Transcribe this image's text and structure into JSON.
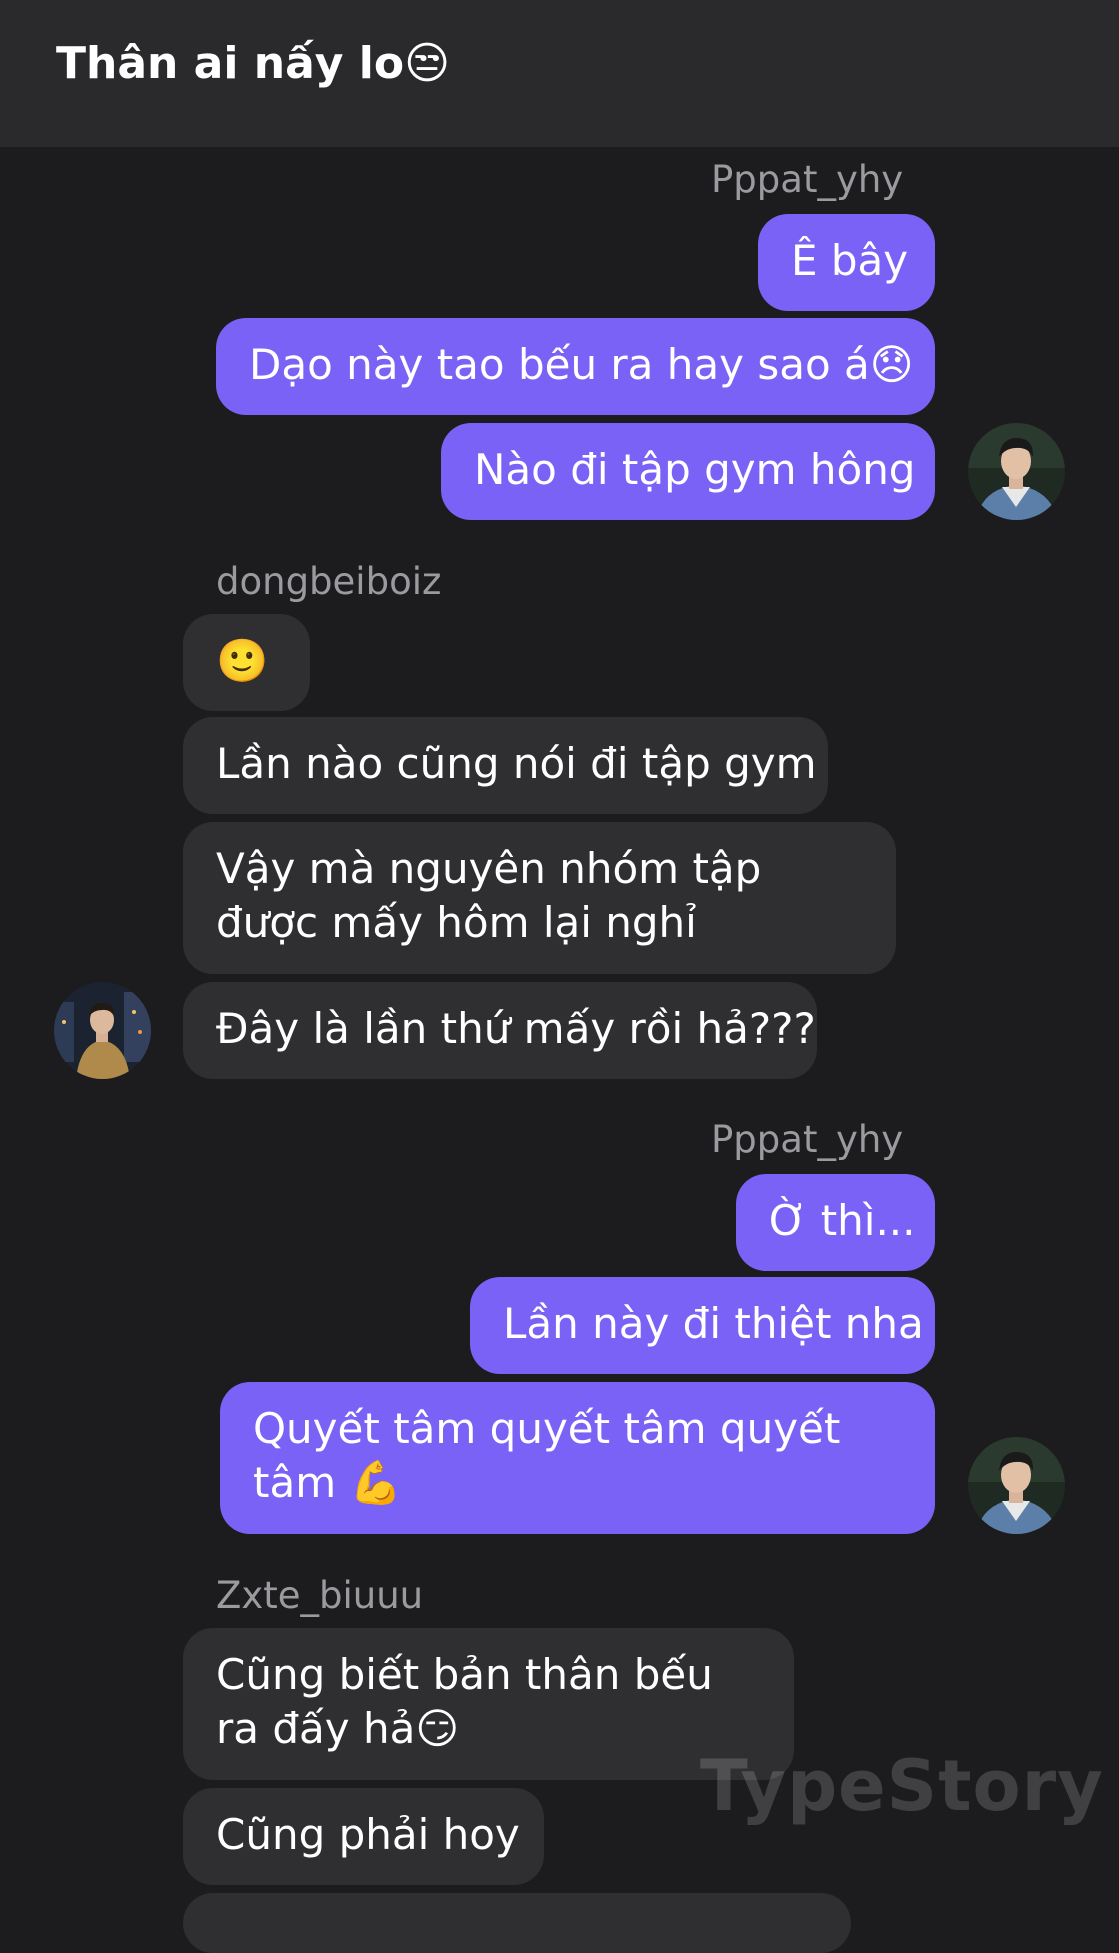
{
  "header": {
    "title": "Thân ai nấy lo😒"
  },
  "groups": [
    {
      "sender": "Pppat_yhy",
      "messages": [
        "Ê bây",
        "Dạo này tao bếu ra hay sao á😞",
        "Nào đi tập gym hông"
      ]
    },
    {
      "sender": "dongbeiboiz",
      "messages": [
        "🙂",
        "Lần nào cũng nói đi tập gym",
        "Vậy mà nguyên nhóm tập được mấy hôm lại nghỉ",
        "Đây là lần thứ mấy rồi hả???"
      ]
    },
    {
      "sender": "Pppat_yhy",
      "messages": [
        "Ờ thì...",
        "Lần này đi thiệt nha",
        "Quyết tâm quyết tâm quyết tâm 💪"
      ]
    },
    {
      "sender": "Zxte_biuuu",
      "messages": [
        "Cũng biết bản thân bếu ra đấy hả😏",
        "Cũng phải hoy"
      ]
    }
  ],
  "watermark": "TypeStory",
  "colors": {
    "outgoing_bubble": "#7962f5",
    "incoming_bubble": "#2f2f31",
    "background": "#1c1c1e",
    "header_bg": "#2a2a2c"
  },
  "icons": {
    "avatar_outgoing": "avatar-man-denim-jacket",
    "avatar_incoming": "avatar-man-city-night"
  }
}
